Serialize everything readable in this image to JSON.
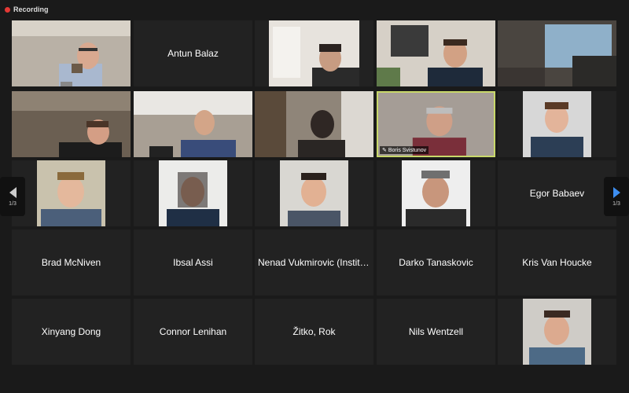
{
  "recording": {
    "label": "Recording",
    "color": "#e53935"
  },
  "pager": {
    "left": "1/3",
    "right": "1/3",
    "active_color": "#3d8ef0"
  },
  "tiles": {
    "r1c2": "Antun Balaz",
    "r2c4": "Boris Svistunov",
    "r3c5": "Egor Babaev",
    "r4c1": "Brad McNiven",
    "r4c2": "Ibsal Assi",
    "r4c3": "Nenad Vukmirovic (Institut...",
    "r4c4": "Darko Tanaskovic",
    "r4c5": "Kris Van Houcke",
    "r5c1": "Xinyang Dong",
    "r5c2": "Connor Lenihan",
    "r5c3": "Žitko, Rok",
    "r5c4": "Nils Wentzell"
  },
  "active_speaker_color": "#c8d86a"
}
